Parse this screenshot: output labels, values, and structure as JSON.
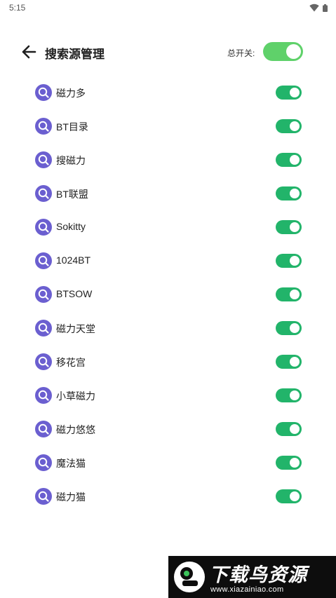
{
  "status_bar": {
    "time": "5:15"
  },
  "header": {
    "title": "搜索源管理",
    "master_switch_label": "总开关:"
  },
  "sources": [
    {
      "label": "磁力多",
      "enabled": true
    },
    {
      "label": "BT目录",
      "enabled": true
    },
    {
      "label": "搜磁力",
      "enabled": true
    },
    {
      "label": "BT联盟",
      "enabled": true
    },
    {
      "label": "Sokitty",
      "enabled": true
    },
    {
      "label": "1024BT",
      "enabled": true
    },
    {
      "label": "BTSOW",
      "enabled": true
    },
    {
      "label": "磁力天堂",
      "enabled": true
    },
    {
      "label": "移花宫",
      "enabled": true
    },
    {
      "label": "小草磁力",
      "enabled": true
    },
    {
      "label": "磁力悠悠",
      "enabled": true
    },
    {
      "label": "魔法猫",
      "enabled": true
    },
    {
      "label": "磁力猫",
      "enabled": true
    }
  ],
  "watermark": {
    "brand": "下载鸟资源",
    "url": "www.xiazainiao.com"
  },
  "colors": {
    "master_toggle_on": "#5fd16a",
    "row_toggle_on": "#22b46a",
    "source_icon": "#6b5fd0"
  },
  "icons": {
    "back": "arrow-left-icon",
    "source": "search-magnifier-icon",
    "wifi": "wifi-icon",
    "battery": "battery-icon"
  }
}
